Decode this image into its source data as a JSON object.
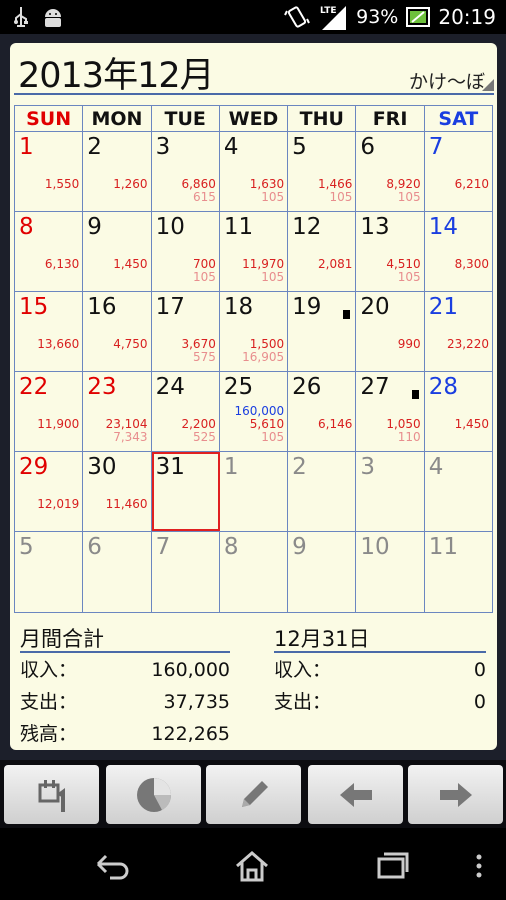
{
  "status": {
    "battery": "93%",
    "time": "20:19",
    "network": "LTE"
  },
  "header": {
    "title": "2013年12月",
    "account": "かけ～ぼ"
  },
  "weekdays": [
    "SUN",
    "MON",
    "TUE",
    "WED",
    "THU",
    "FRI",
    "SAT"
  ],
  "weeks": [
    [
      {
        "d": "1",
        "a1": "1,550"
      },
      {
        "d": "2",
        "a1": "1,260"
      },
      {
        "d": "3",
        "a1": "6,860",
        "a2": "615"
      },
      {
        "d": "4",
        "a1": "1,630",
        "a2": "105"
      },
      {
        "d": "5",
        "a1": "1,466",
        "a2": "105"
      },
      {
        "d": "6",
        "a1": "8,920",
        "a2": "105"
      },
      {
        "d": "7",
        "a1": "6,210"
      }
    ],
    [
      {
        "d": "8",
        "a1": "6,130"
      },
      {
        "d": "9",
        "a1": "1,450"
      },
      {
        "d": "10",
        "a1": "700",
        "a2": "105"
      },
      {
        "d": "11",
        "a1": "11,970",
        "a2": "105"
      },
      {
        "d": "12",
        "a1": "2,081"
      },
      {
        "d": "13",
        "a1": "4,510",
        "a2": "105"
      },
      {
        "d": "14",
        "a1": "8,300"
      }
    ],
    [
      {
        "d": "15",
        "a1": "13,660"
      },
      {
        "d": "16",
        "a1": "4,750"
      },
      {
        "d": "17",
        "a1": "3,670",
        "a2": "575"
      },
      {
        "d": "18",
        "a1": "1,500",
        "a2": "16,905"
      },
      {
        "d": "19",
        "mark": true
      },
      {
        "d": "20",
        "a1": "990"
      },
      {
        "d": "21",
        "a1": "23,220"
      }
    ],
    [
      {
        "d": "22",
        "a1": "11,900"
      },
      {
        "d": "23",
        "a1": "23,104",
        "a2": "7,343",
        "holiday": true
      },
      {
        "d": "24",
        "a1": "2,200",
        "a2": "525"
      },
      {
        "d": "25",
        "inc": "160,000",
        "a1": "5,610",
        "a2": "105"
      },
      {
        "d": "26",
        "a1": "6,146"
      },
      {
        "d": "27",
        "a1": "1,050",
        "a2": "110",
        "mark": true
      },
      {
        "d": "28",
        "a1": "1,450"
      }
    ],
    [
      {
        "d": "29",
        "a1": "12,019"
      },
      {
        "d": "30",
        "a1": "11,460"
      },
      {
        "d": "31",
        "today": true
      },
      {
        "d": "1",
        "other": true
      },
      {
        "d": "2",
        "other": true
      },
      {
        "d": "3",
        "other": true
      },
      {
        "d": "4",
        "other": true
      }
    ],
    [
      {
        "d": "5",
        "other": true
      },
      {
        "d": "6",
        "other": true
      },
      {
        "d": "7",
        "other": true
      },
      {
        "d": "8",
        "other": true
      },
      {
        "d": "9",
        "other": true
      },
      {
        "d": "10",
        "other": true
      },
      {
        "d": "11",
        "other": true
      }
    ]
  ],
  "monthly": {
    "title": "月間合計",
    "income_label": "収入：",
    "income": "160,000",
    "expense_label": "支出：",
    "expense": "37,735",
    "balance_label": "残高：",
    "balance": "122,265"
  },
  "daily": {
    "title": "12月31日",
    "income_label": "収入：",
    "income": "0",
    "expense_label": "支出：",
    "expense": "0"
  },
  "colors": {
    "sunday": "#e00000",
    "saturday": "#1a3ee0",
    "expense": "#d82020",
    "income": "#1a3ee0",
    "today_border": "#e02020",
    "grid": "#6b86c0"
  },
  "toolbar": [
    "calendar-today-icon",
    "pie-chart-icon",
    "pencil-icon",
    "arrow-left-icon",
    "arrow-right-icon"
  ]
}
